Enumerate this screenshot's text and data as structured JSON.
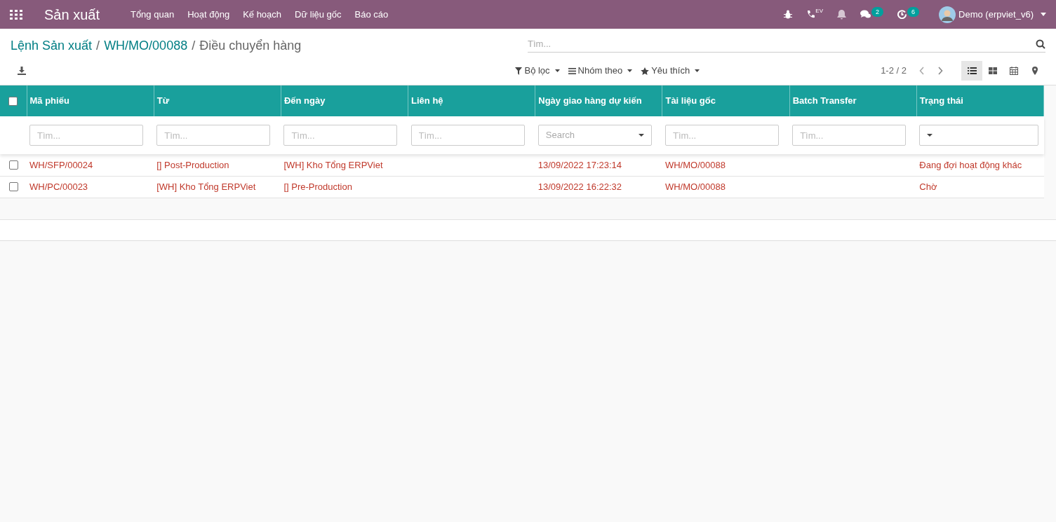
{
  "navbar": {
    "app_title": "Sản xuất",
    "menu": [
      "Tổng quan",
      "Hoạt động",
      "Kế hoạch",
      "Dữ liệu gốc",
      "Báo cáo"
    ],
    "systray": [
      {
        "kind": "bug"
      },
      {
        "kind": "phone",
        "label": "EV"
      },
      {
        "kind": "bell"
      },
      {
        "kind": "chat",
        "badge": "2"
      },
      {
        "kind": "clock",
        "badge": "6"
      }
    ],
    "user": "Demo (erpviet_v6)"
  },
  "breadcrumb": [
    {
      "label": "Lệnh Sản xuất"
    },
    {
      "separator": "/",
      "label": "WH/MO/00088"
    },
    {
      "separator": "/",
      "label": "Điều chuyển hàng"
    }
  ],
  "search": {
    "placeholder": "Tìm..."
  },
  "toolbar": [
    {
      "kind": "filter",
      "label": "Bộ lọc"
    },
    {
      "kind": "group",
      "label": "Nhóm theo"
    },
    {
      "kind": "star",
      "label": "Yêu thích"
    }
  ],
  "pager": "1-2 / 2",
  "views": [
    {
      "kind": "list",
      "selected": true
    },
    {
      "kind": "kanban",
      "selected": false
    },
    {
      "kind": "calendar",
      "selected": false
    },
    {
      "kind": "map",
      "selected": false
    }
  ],
  "table": {
    "all_checked": false,
    "columns": [
      {
        "label": "Mã phiếu",
        "filter": {
          "kind": "input",
          "placeholder": "Tìm..."
        }
      },
      {
        "label": "Từ",
        "filter": {
          "kind": "input",
          "placeholder": "Tìm..."
        }
      },
      {
        "label": "Đến ngày",
        "filter": {
          "kind": "input",
          "placeholder": "Tìm..."
        }
      },
      {
        "label": "Liên hệ",
        "filter": {
          "kind": "input",
          "placeholder": "Tìm..."
        }
      },
      {
        "label": "Ngày giao hàng dự kiến",
        "filter": {
          "kind": "select",
          "placeholder": "Search"
        }
      },
      {
        "label": "Tài liệu gốc",
        "filter": {
          "kind": "input",
          "placeholder": "Tìm..."
        }
      },
      {
        "label": "Batch Transfer",
        "filter": {
          "kind": "input",
          "placeholder": "Tìm..."
        }
      },
      {
        "label": "Trạng thái",
        "filter": {
          "kind": "select"
        }
      }
    ],
    "rows": [
      {
        "checked": false,
        "cells": [
          "WH/SFP/00024",
          "[] Post-Production",
          "[WH] Kho Tổng ERPViet",
          "",
          "13/09/2022 17:23:14",
          "WH/MO/00088",
          "",
          "Đang đợi hoạt động khác"
        ]
      },
      {
        "checked": false,
        "cells": [
          "WH/PC/00023",
          "[WH] Kho Tổng ERPViet",
          "[] Pre-Production",
          "",
          "13/09/2022 16:22:32",
          "WH/MO/00088",
          "",
          "Chờ"
        ]
      }
    ]
  }
}
